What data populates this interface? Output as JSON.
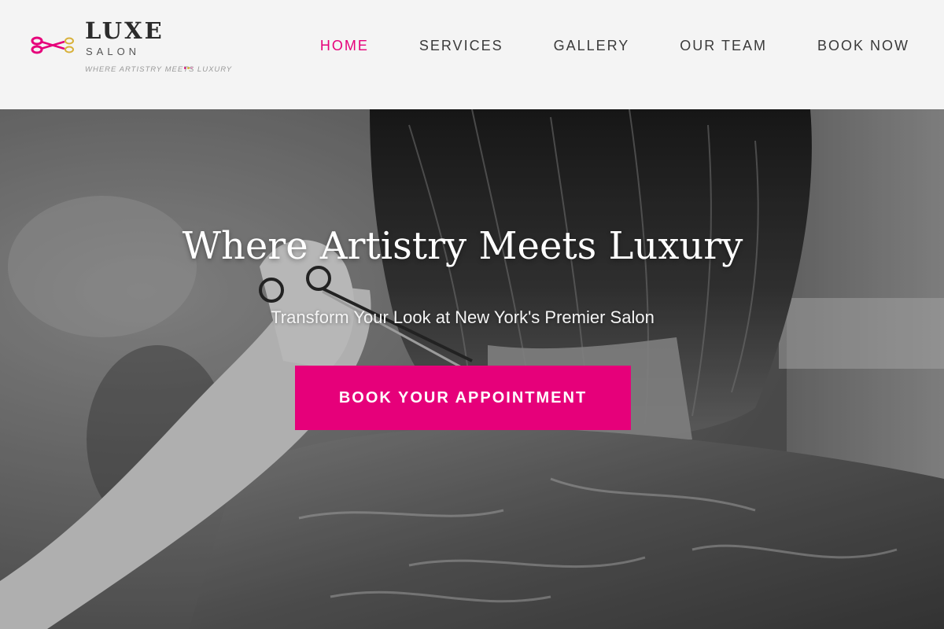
{
  "brand": {
    "name": "LUXE",
    "subtitle": "SALON",
    "tagline": "WHERE ARTISTRY MEETS LUXURY",
    "colors": {
      "accent": "#e6007a",
      "gold": "#d8b13a",
      "dark": "#2b2b2b"
    },
    "icon": "scissors-icon"
  },
  "nav": {
    "items": [
      {
        "label": "HOME",
        "active": true
      },
      {
        "label": "SERVICES",
        "active": false
      },
      {
        "label": "GALLERY",
        "active": false
      },
      {
        "label": "OUR TEAM",
        "active": false
      },
      {
        "label": "BOOK NOW",
        "active": false
      }
    ]
  },
  "hero": {
    "title": "Where Artistry Meets Luxury",
    "subtitle": "Transform Your Look at New York's Premier Salon",
    "cta_label": "BOOK YOUR APPOINTMENT",
    "image": "grayscale photo of stylist cutting hair"
  }
}
